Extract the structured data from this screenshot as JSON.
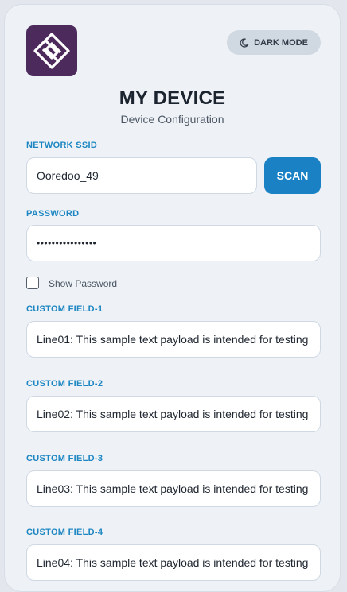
{
  "header": {
    "logo_icon": "brand-logo-icon",
    "dark_mode_label": "DARK MODE",
    "dark_mode_icon": "moon-icon",
    "title": "MY DEVICE",
    "subtitle": "Device Configuration"
  },
  "network": {
    "ssid_label": "NETWORK SSID",
    "ssid_value": "Ooredoo_49",
    "scan_label": "SCAN",
    "password_label": "PASSWORD",
    "password_value": "••••••••••••••••",
    "show_password_label": "Show Password",
    "show_password_checked": false
  },
  "custom_fields": [
    {
      "label": "CUSTOM FIELD-1",
      "value": "Line01: This sample text payload is intended for testing"
    },
    {
      "label": "CUSTOM FIELD-2",
      "value": "Line02: This sample text payload is intended for testing"
    },
    {
      "label": "CUSTOM FIELD-3",
      "value": "Line03: This sample text payload is intended for testing"
    },
    {
      "label": "CUSTOM FIELD-4",
      "value": "Line04: This sample text payload is intended for testing"
    }
  ],
  "colors": {
    "accent": "#1a82c4",
    "label": "#1d86c2",
    "logo_bg": "#4c2a5c"
  }
}
